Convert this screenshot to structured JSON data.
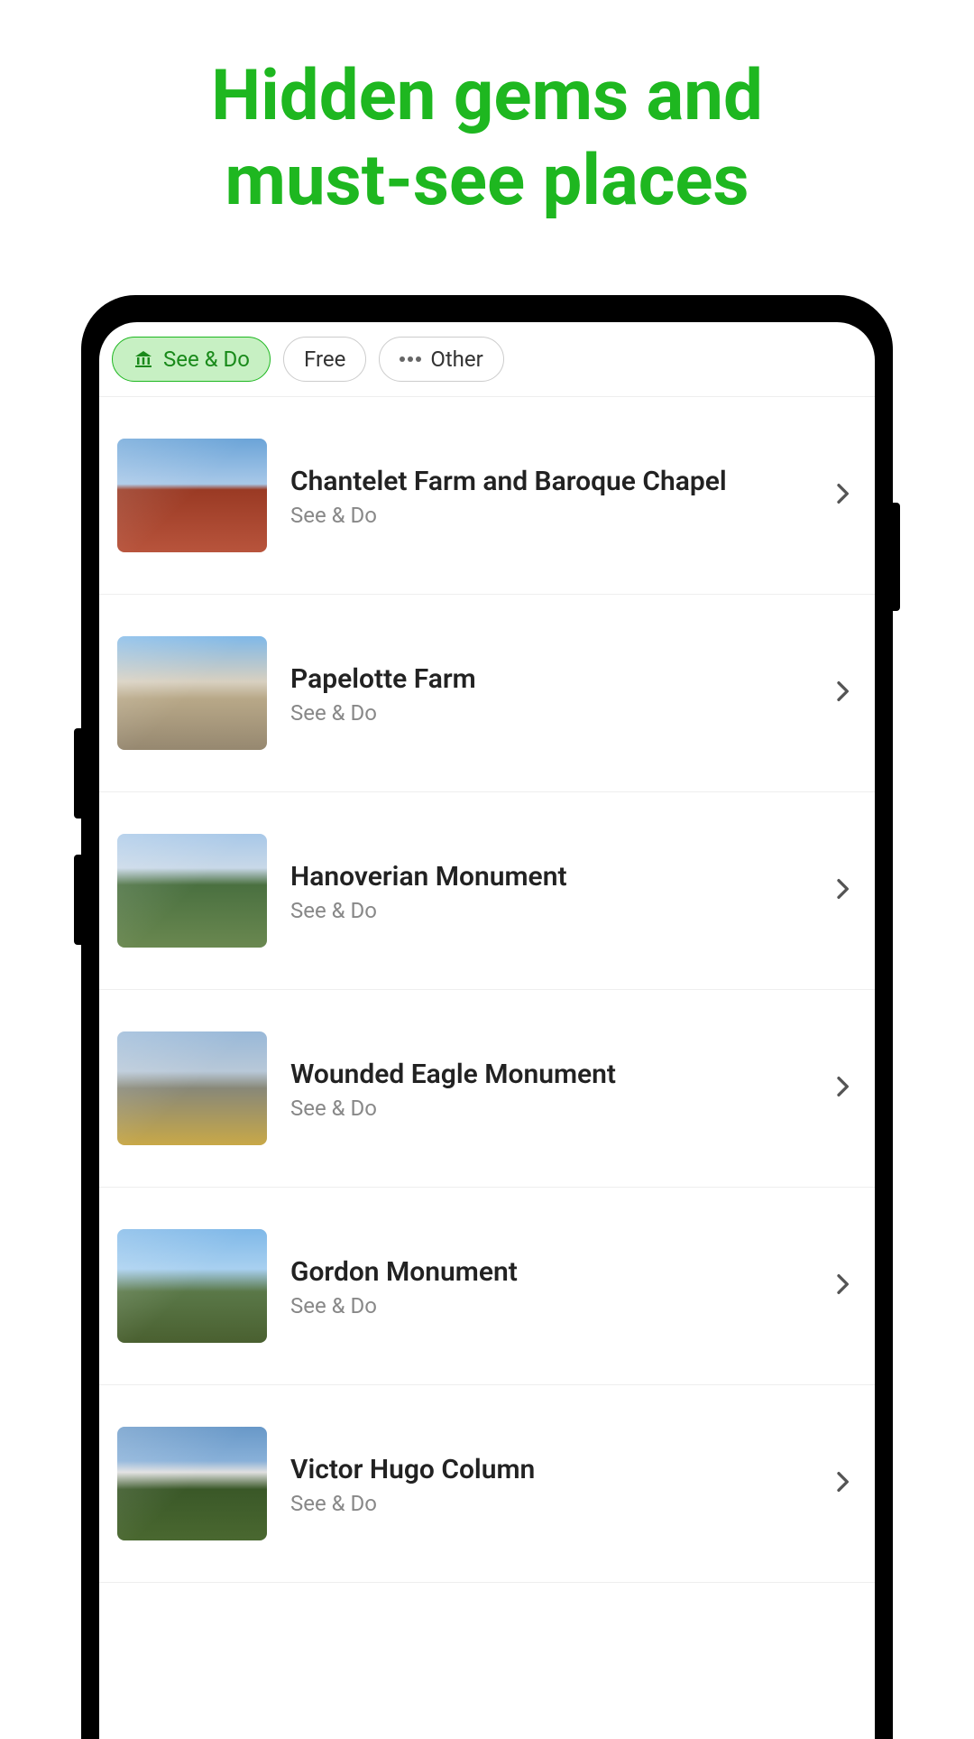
{
  "promo": {
    "title_line1": "Hidden gems and",
    "title_line2": "must-see places"
  },
  "filters": [
    {
      "label": "See & Do",
      "icon": "museum-icon",
      "active": true
    },
    {
      "label": "Free",
      "icon": null,
      "active": false
    },
    {
      "label": "Other",
      "icon": "dots-icon",
      "active": false
    }
  ],
  "items": [
    {
      "title": "Chantelet Farm and Baroque Chapel",
      "subtitle": "See & Do",
      "thumb": "thumb-building"
    },
    {
      "title": "Papelotte Farm",
      "subtitle": "See & Do",
      "thumb": "thumb-farm"
    },
    {
      "title": "Hanoverian Monument",
      "subtitle": "See & Do",
      "thumb": "thumb-monument"
    },
    {
      "title": "Wounded Eagle Monument",
      "subtitle": "See & Do",
      "thumb": "thumb-eagle"
    },
    {
      "title": "Gordon Monument",
      "subtitle": "See & Do",
      "thumb": "thumb-column"
    },
    {
      "title": "Victor Hugo Column",
      "subtitle": "See & Do",
      "thumb": "thumb-hugo"
    }
  ]
}
